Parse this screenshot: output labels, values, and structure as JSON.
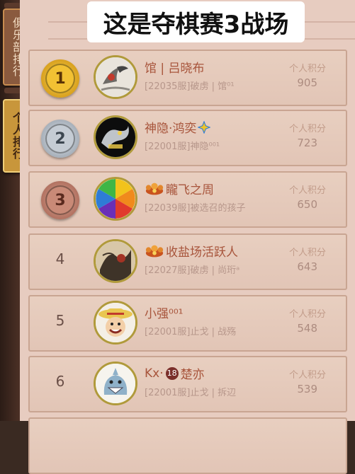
{
  "overlay_title": "这是夺棋赛3战场",
  "side_tabs": [
    {
      "label": "俱乐部排行",
      "active": false
    },
    {
      "label": "个人排行",
      "active": true
    }
  ],
  "score_label": "个人积分",
  "rows": [
    {
      "rank": "1",
      "name": "馆 | 吕晓布",
      "info": "[22035服]破虏 | 馆⁰¹",
      "score": "905"
    },
    {
      "rank": "2",
      "name": "神隐·鸿奕",
      "info": "[22001服]神隐⁰⁰¹",
      "score": "723"
    },
    {
      "rank": "3",
      "name": "矓飞之周",
      "info": "[22039服]被选召的孩子",
      "score": "650"
    },
    {
      "rank": "4",
      "name": "收盐场活跃人",
      "info": "[22027服]破虏 | 尚珩ᵃ",
      "score": "643"
    },
    {
      "rank": "5",
      "name": "小强⁰⁰¹",
      "info": "[22001服]止戈 | 战殇",
      "score": "548"
    },
    {
      "rank": "6",
      "name_prefix": "Kx·",
      "badge": "18",
      "name": "楚亦",
      "info": "[22001服]止戈 | 拆辺",
      "score": "539"
    }
  ]
}
